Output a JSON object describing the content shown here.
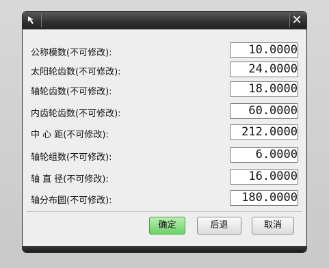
{
  "dialog": {
    "title_icon": "arrow-cursor-icon",
    "close_symbol": "✕"
  },
  "fields": [
    {
      "label": "公称模数(不可修改):",
      "value": "10.0000"
    },
    {
      "label": "太阳轮齿数(不可修改):",
      "value": "24.0000"
    },
    {
      "label": "轴轮齿数(不可修改):",
      "value": "18.0000"
    },
    {
      "label": "内齿轮齿数(不可修改):",
      "value": "60.0000"
    },
    {
      "label": "中 心 距(不可修改):",
      "value": "212.0000"
    },
    {
      "label": "轴轮组数(不可修改):",
      "value": "6.0000"
    },
    {
      "label": "轴 直 径(不可修改):",
      "value": "16.0000"
    },
    {
      "label": "轴分布圆(不可修改):",
      "value": "180.0000"
    }
  ],
  "buttons": {
    "ok": "确定",
    "back": "后退",
    "cancel": "取消"
  },
  "colors": {
    "ok_button": "#7fd97a",
    "title_bar": "#2e2e2e"
  }
}
